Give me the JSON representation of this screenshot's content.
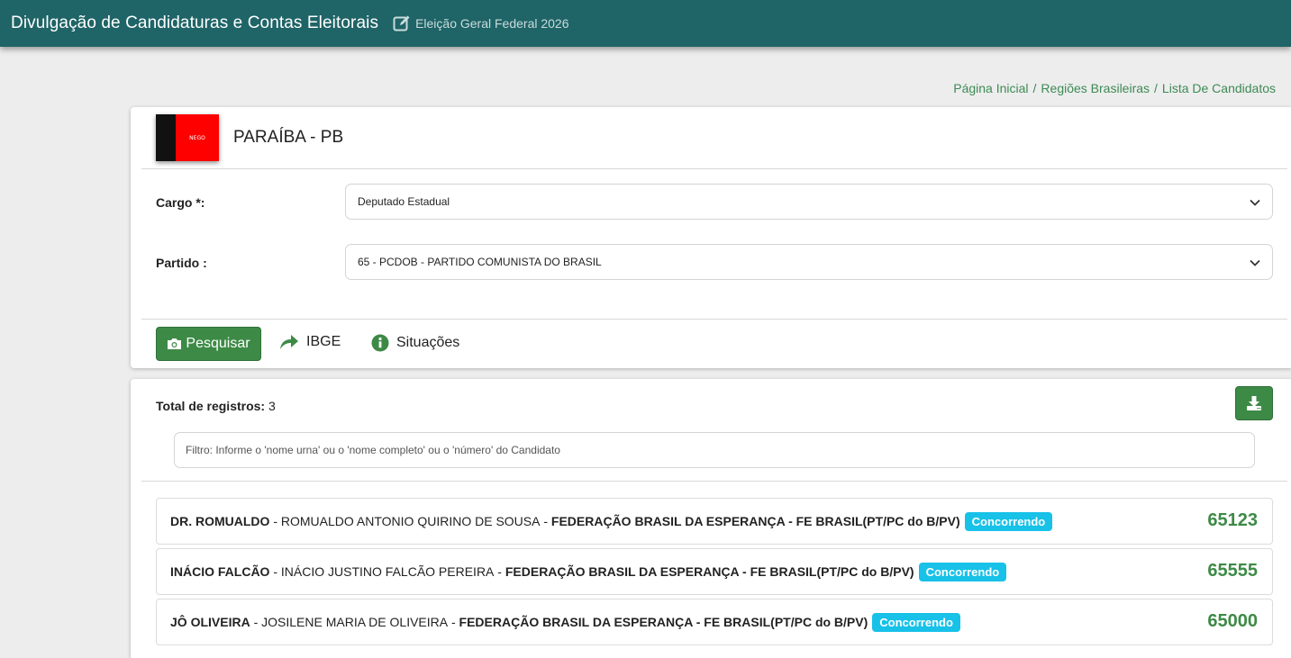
{
  "header": {
    "app_title": "Divulgação de Candidaturas e Contas Eleitorais",
    "election": "Eleição Geral Federal 2026",
    "edit_icon": "edit-icon"
  },
  "breadcrumb": {
    "items": [
      "Página Inicial",
      "Regiões Brasileiras",
      "Lista De Candidatos"
    ],
    "separator": "/"
  },
  "state": {
    "flag_text": "NEGO",
    "name": "PARAÍBA - PB"
  },
  "form": {
    "cargo_label": "Cargo *:",
    "cargo_value": "Deputado Estadual",
    "partido_label": "Partido :",
    "partido_value": "65 - PCDOB - PARTIDO COMUNISTA DO BRASIL"
  },
  "actions": {
    "search_label": "Pesquisar",
    "ibge_label": "IBGE",
    "situacoes_label": "Situações"
  },
  "results": {
    "total_label": "Total de registros:",
    "total_value": "3",
    "filter_placeholder": "Filtro: Informe o 'nome urna' ou o 'nome completo' ou o 'número' do Candidato",
    "candidates": [
      {
        "nickname": "DR. ROMUALDO",
        "full_name": "ROMUALDO ANTONIO QUIRINO DE SOUSA",
        "party": "FEDERAÇÃO BRASIL DA ESPERANÇA - FE BRASIL(PT/PC do B/PV)",
        "status": "Concorrendo",
        "number": "65123"
      },
      {
        "nickname": "INÁCIO FALCÃO",
        "full_name": "INÁCIO JUSTINO FALCÃO PEREIRA",
        "party": "FEDERAÇÃO BRASIL DA ESPERANÇA - FE BRASIL(PT/PC do B/PV)",
        "status": "Concorrendo",
        "number": "65555"
      },
      {
        "nickname": "JÔ OLIVEIRA",
        "full_name": "JOSILENE MARIA DE OLIVEIRA",
        "party": "FEDERAÇÃO BRASIL DA ESPERANÇA - FE BRASIL(PT/PC do B/PV)",
        "status": "Concorrendo",
        "number": "65000"
      }
    ]
  },
  "colors": {
    "topbar": "#1f6467",
    "accent_green": "#3d8a46",
    "badge_blue": "#17c1e8"
  }
}
